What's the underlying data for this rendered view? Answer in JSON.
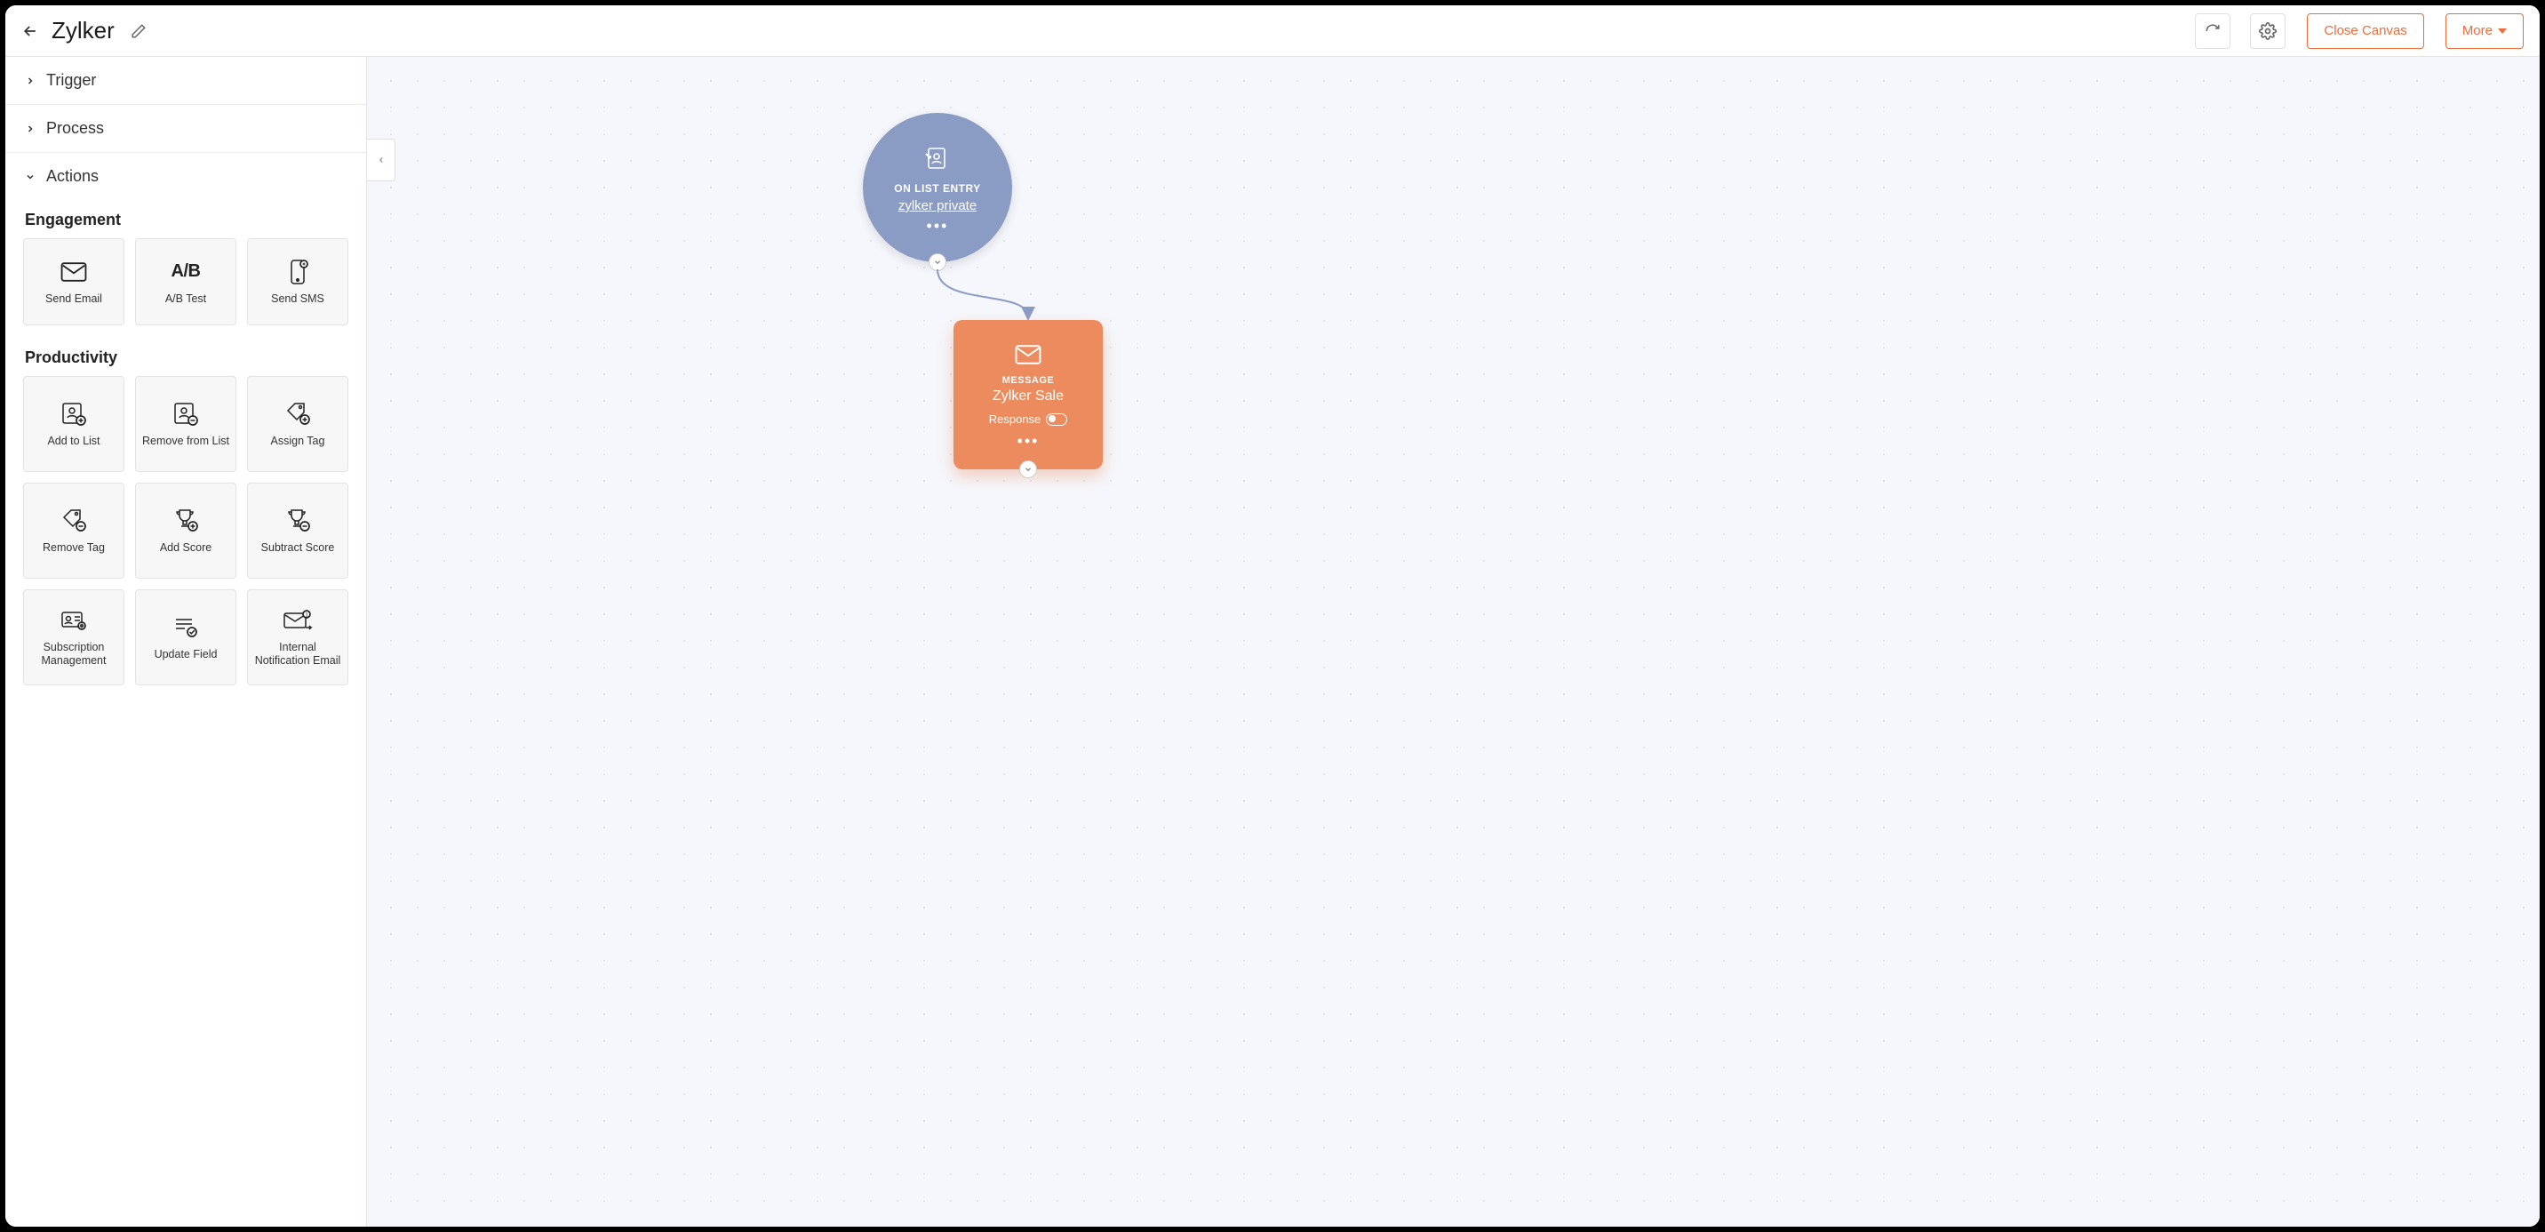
{
  "header": {
    "workflow_title": "Zylker",
    "close_label": "Close Canvas",
    "more_label": "More"
  },
  "sidebar": {
    "sections": {
      "trigger": "Trigger",
      "process": "Process",
      "actions": "Actions"
    },
    "groups": {
      "engagement": {
        "title": "Engagement",
        "tiles": [
          {
            "id": "send-email",
            "label": "Send Email"
          },
          {
            "id": "ab-test",
            "label": "A/B Test"
          },
          {
            "id": "send-sms",
            "label": "Send SMS"
          }
        ]
      },
      "productivity": {
        "title": "Productivity",
        "tiles": [
          {
            "id": "add-to-list",
            "label": "Add to List"
          },
          {
            "id": "remove-from-list",
            "label": "Remove from List"
          },
          {
            "id": "assign-tag",
            "label": "Assign Tag"
          },
          {
            "id": "remove-tag",
            "label": "Remove Tag"
          },
          {
            "id": "add-score",
            "label": "Add Score"
          },
          {
            "id": "subtract-score",
            "label": "Subtract Score"
          },
          {
            "id": "subscription-management",
            "label": "Subscription Management"
          },
          {
            "id": "update-field",
            "label": "Update Field"
          },
          {
            "id": "internal-notification-email",
            "label": "Internal Notification Email"
          }
        ]
      }
    }
  },
  "canvas": {
    "trigger_node": {
      "type_label": "ON LIST ENTRY",
      "value": "zylker private"
    },
    "message_node": {
      "type_label": "MESSAGE",
      "value": "Zylker Sale",
      "response_label": "Response"
    }
  }
}
